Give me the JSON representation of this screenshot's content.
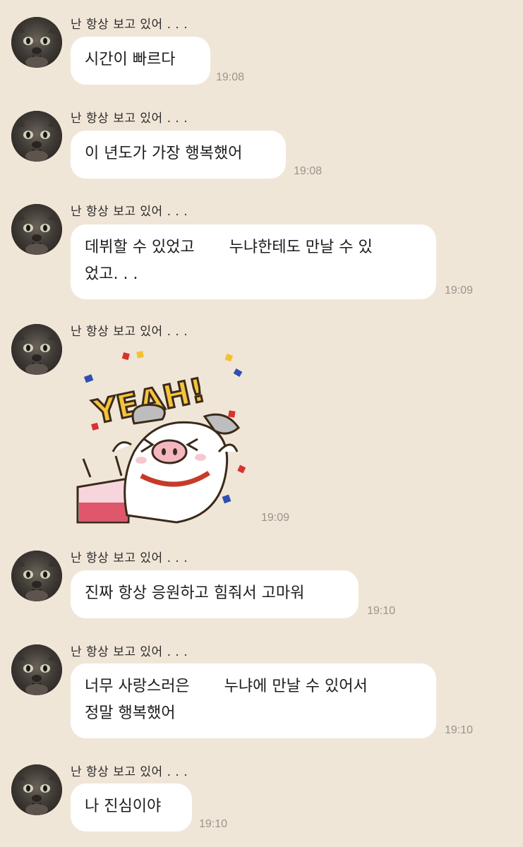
{
  "sender_name": "난 항상 보고 있어 . . .",
  "messages": [
    {
      "text": "시간이 빠르다",
      "time": "19:08"
    },
    {
      "text": "이 년도가 가장 행복했어",
      "time": "19:08"
    },
    {
      "text": "데뷔할 수 있었고       누냐한테도 만날 수 있\n었고. . .",
      "time": "19:09"
    },
    {
      "sticker": "yeah-pig-sticker",
      "sticker_text": "YEAH!",
      "time": "19:09"
    },
    {
      "text": "진짜 항상 응원하고 힘줘서 고마워",
      "time": "19:10"
    },
    {
      "text": "너무 사랑스러은       누냐에 만날 수 있어서\n정말 행복했어",
      "time": "19:10"
    },
    {
      "text": "나 진심이야",
      "time": "19:10"
    }
  ],
  "colors": {
    "background": "#f0e6d8",
    "bubble": "#ffffff",
    "timestamp": "#9a948c"
  }
}
